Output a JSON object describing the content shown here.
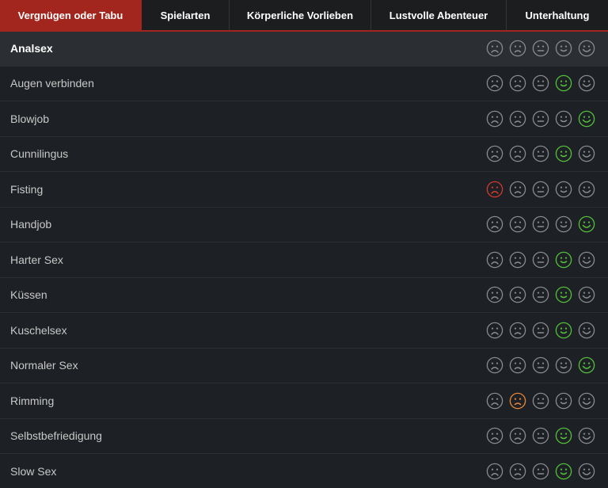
{
  "tabs": [
    {
      "label": "Vergnügen oder Tabu",
      "active": true
    },
    {
      "label": "Spielarten",
      "active": false
    },
    {
      "label": "Körperliche Vorlieben",
      "active": false
    },
    {
      "label": "Lustvolle Abenteuer",
      "active": false
    },
    {
      "label": "Unterhaltung",
      "active": false
    }
  ],
  "colors": {
    "accent": "#a3261e",
    "neutral_face": "#8a8d90",
    "selected_red": "#d43a2f",
    "selected_orange": "#e8873a",
    "selected_green": "#54c23a"
  },
  "face_icons": [
    "very-sad-face-icon",
    "sad-face-icon",
    "neutral-face-icon",
    "smile-face-icon",
    "big-smile-face-icon"
  ],
  "rows": [
    {
      "label": "Analsex",
      "header": true,
      "selected": null
    },
    {
      "label": "Augen verbinden",
      "selected": 3
    },
    {
      "label": "Blowjob",
      "selected": 4
    },
    {
      "label": "Cunnilingus",
      "selected": 3
    },
    {
      "label": "Fisting",
      "selected": 0
    },
    {
      "label": "Handjob",
      "selected": 4
    },
    {
      "label": "Harter Sex",
      "selected": 3
    },
    {
      "label": "Küssen",
      "selected": 3
    },
    {
      "label": "Kuschelsex",
      "selected": 3
    },
    {
      "label": "Normaler Sex",
      "selected": 4
    },
    {
      "label": "Rimming",
      "selected": 1
    },
    {
      "label": "Selbstbefriedigung",
      "selected": 3
    },
    {
      "label": "Slow Sex",
      "selected": 3
    }
  ]
}
